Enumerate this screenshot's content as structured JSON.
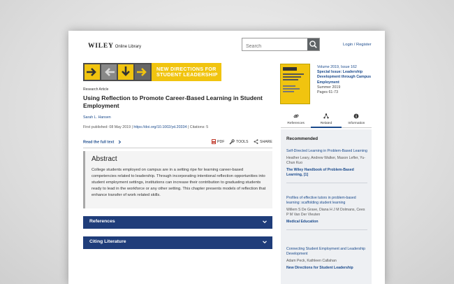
{
  "header": {
    "logo_brand": "WILEY",
    "logo_sub": "Online Library",
    "search_placeholder": "Search",
    "login_label": "Login / Register"
  },
  "banner": {
    "journal_line1": "NEW DIRECTIONS FOR",
    "journal_line2": "STUDENT LEADERSHIP"
  },
  "article": {
    "type": "Research Article",
    "title": "Using Reflection to Promote Career-Based Learning in Student Employment",
    "author": "Sarah L. Hansen",
    "first_published_label": "First published:",
    "first_published_date": "08 May 2019",
    "separator": "|",
    "doi": "https://doi.org/10.1002/yd.20334",
    "citations": "Citations: 5",
    "read_full_text": "Read the full text",
    "tools": {
      "pdf": "PDF",
      "tools": "TOOLS",
      "share": "SHARE"
    }
  },
  "abstract": {
    "heading": "Abstract",
    "text": "College students employed on campus are in a setting ripe for learning career-based competencies related to leadership. Through incorporating intentional reflection opportunities into student employment settings, institutions can increase their contribution to graduating students ready to lead in the workforce or any other setting. This chapter presents models of reflection that enhance transfer of work related skills."
  },
  "accordions": {
    "references": "References",
    "citing": "Citing Literature"
  },
  "issue": {
    "volume": "Volume 2019, Issue 162",
    "special_issue": "Special Issue: Leadership Development through Campus Employment",
    "season": "Summer 2019",
    "pages": "Pages 61-73"
  },
  "side_tabs": {
    "references": "References",
    "related": "Related",
    "information": "Information"
  },
  "recommended": {
    "heading": "Recommended",
    "items": [
      {
        "title": "Self-Directed Learning in Problem-Based Learning",
        "authors": "Heather Leary, Andrew Walker, Mason Lefler, Yu-Chun Kuo",
        "journal": "The Wiley Handbook of Problem-Based Learning, [1]"
      },
      {
        "title": "Profiles of effective tutors in problem-based learning: scaffolding student learning",
        "authors": "Willem S De Grave, Diana H J M Dolmans, Cees P M Van Der Vleuten",
        "journal": "Medical Education"
      },
      {
        "title": "Connecting Student Employment and Leadership Development",
        "authors": "Adam Peck, Kathleen Callahan",
        "journal": "New Directions for Student Leadership"
      }
    ]
  },
  "colors": {
    "accent_blue": "#1a4a8c",
    "accordion_navy": "#1f3d7a",
    "journal_yellow": "#f1c40f"
  }
}
